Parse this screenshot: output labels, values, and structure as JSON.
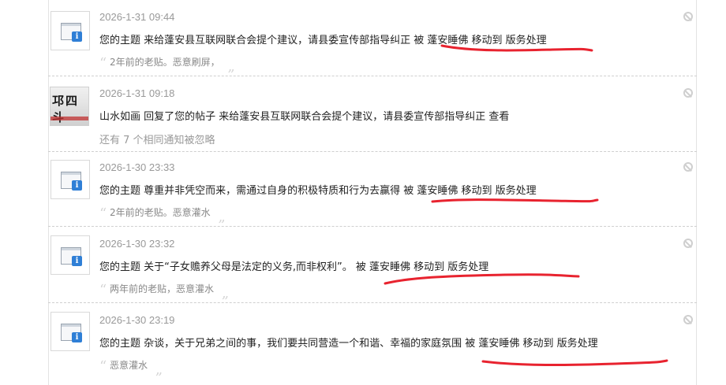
{
  "notifications": [
    {
      "time": "2026-1-31 09:44",
      "text": "您的主题 来给蓬安县互联网联合会提个建议，请县委宣传部指导纠正 被 蓬安睡佛 移动到 版务处理",
      "note": "2年前的老贴。恶意刷屏，",
      "icon": "system-notice-icon"
    },
    {
      "time": "2026-1-31 09:18",
      "text": "山水如画 回复了您的帖子 来给蓬安县互联网联合会提个建议，请县委宣传部指导纠正   查看",
      "extra": "还有 7 个相同通知被忽略",
      "avatar_text": "邛四斗",
      "icon": "user-avatar"
    },
    {
      "time": "2026-1-30 23:33",
      "text": "您的主题 尊重并非凭空而来，需通过自身的积极特质和行为去赢得 被 蓬安睡佛 移动到 版务处理",
      "note": "2年前的老贴。恶意灌水",
      "icon": "system-notice-icon"
    },
    {
      "time": "2026-1-30 23:32",
      "text": "您的主题 关于“子女赡养父母是法定的义务,而非权利”。 被 蓬安睡佛 移动到 版务处理",
      "note": "两年前的老贴，恶意灌水",
      "icon": "system-notice-icon"
    },
    {
      "time": "2026-1-30 23:19",
      "text": "您的主题 杂谈，关于兄弟之间的事，我们要共同营造一个和谐、幸福的家庭氛围 被 蓬安睡佛 移动到 版务处理",
      "note": "恶意灌水",
      "icon": "system-notice-icon"
    }
  ],
  "quote_open": "“",
  "quote_close": "„",
  "colors": {
    "annotation": "#e8232f",
    "time": "#999999",
    "separator": "#cfcfcf"
  }
}
